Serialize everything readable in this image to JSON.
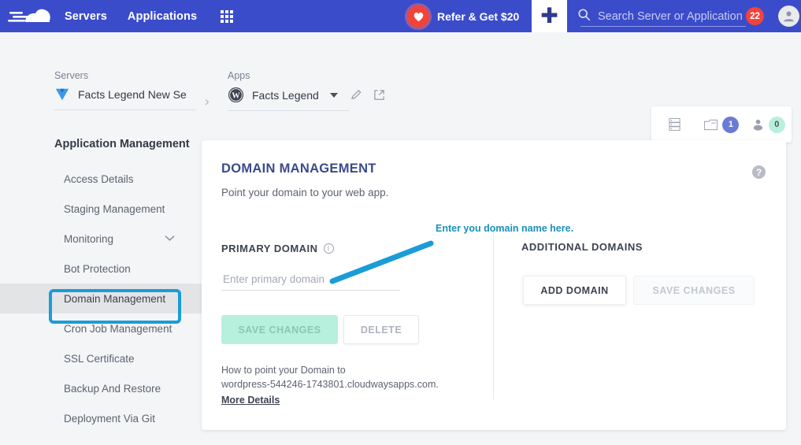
{
  "topnav": {
    "logo": "cloudways-logo",
    "links": [
      {
        "label": "Servers",
        "name": "nav-servers"
      },
      {
        "label": "Applications",
        "name": "nav-applications"
      }
    ],
    "grid_icon": "app-grid-icon",
    "refer": {
      "label": "Refer & Get $20",
      "icon": "heart-icon"
    },
    "plus": {
      "label": "+",
      "icon": "plus-icon"
    },
    "search": {
      "placeholder": "Search Server or Application",
      "icon": "search-icon"
    },
    "notification_count": "22",
    "avatar": "user-avatar-icon",
    "colors": {
      "bar": "#3b4cca",
      "badge": "#f2433b"
    }
  },
  "breadcrumb": {
    "servers": {
      "label": "Servers",
      "value": "Facts Legend New Se",
      "icon": "server-icon"
    },
    "apps": {
      "label": "Apps",
      "value": "Facts Legend",
      "icon": "wordpress-icon"
    },
    "edit_icon": "pencil-icon",
    "launch_icon": "external-link-icon",
    "chevron": "chevron-right-icon"
  },
  "stats": {
    "items": [
      {
        "icon": "server-stack-icon",
        "count": "",
        "name": "stat-servers"
      },
      {
        "icon": "app-folder-icon",
        "count": "1",
        "name": "stat-apps"
      },
      {
        "icon": "team-member-icon",
        "count": "0",
        "name": "stat-members"
      }
    ]
  },
  "sidebar": {
    "title": "Application Management",
    "items": [
      {
        "label": "Access Details",
        "active": false,
        "chevron": false
      },
      {
        "label": "Staging Management",
        "active": false,
        "chevron": false
      },
      {
        "label": "Monitoring",
        "active": false,
        "chevron": true
      },
      {
        "label": "Bot Protection",
        "active": false,
        "chevron": false
      },
      {
        "label": "Domain Management",
        "active": true,
        "chevron": false
      },
      {
        "label": "Cron Job Management",
        "active": false,
        "chevron": false
      },
      {
        "label": "SSL Certificate",
        "active": false,
        "chevron": false
      },
      {
        "label": "Backup And Restore",
        "active": false,
        "chevron": false
      },
      {
        "label": "Deployment Via Git",
        "active": false,
        "chevron": false
      }
    ]
  },
  "main": {
    "title": "DOMAIN MANAGEMENT",
    "subtitle": "Point your domain to your web app.",
    "help_icon": "help-question-icon",
    "primary": {
      "label": "PRIMARY DOMAIN",
      "info_icon": "info-icon",
      "input_value": "",
      "input_placeholder": "Enter primary domain",
      "save_label": "SAVE CHANGES",
      "delete_label": "DELETE",
      "hint_line1": "How to point your Domain to",
      "hint_line2": "wordpress-544246-1743801.cloudwaysapps.com.",
      "more_details": "More Details"
    },
    "additional": {
      "label": "ADDITIONAL DOMAINS",
      "add_label": "ADD DOMAIN",
      "save_label": "SAVE CHANGES"
    }
  },
  "annotations": {
    "callout_text": "Enter you domain name here.",
    "arrow_color": "#1a9cd8",
    "highlight_color": "#1a9cd8",
    "highlight_target": "Domain Management"
  }
}
